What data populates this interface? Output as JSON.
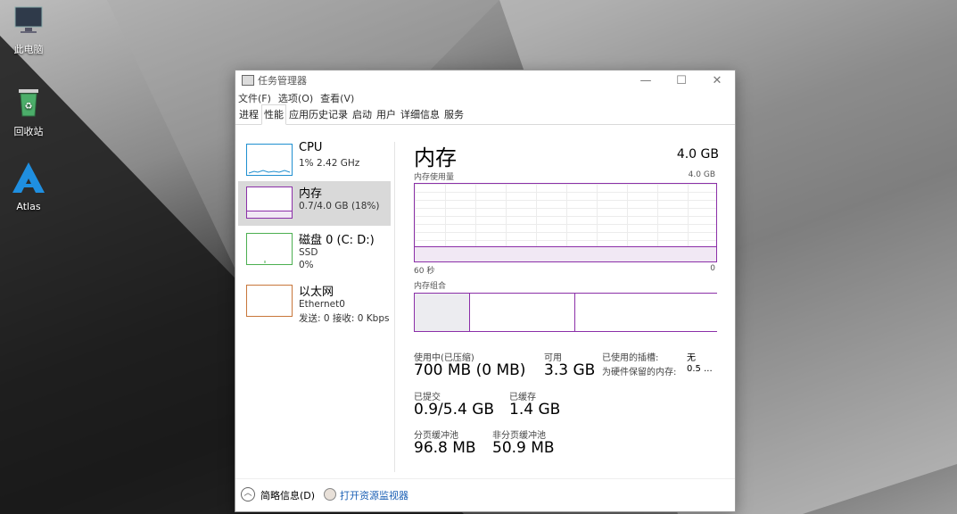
{
  "desktop": {
    "icons": [
      {
        "label": "此电脑",
        "icon": "computer-icon"
      },
      {
        "label": "回收站",
        "icon": "recycle-bin-icon"
      },
      {
        "label": "Atlas",
        "icon": "atlas-logo-icon"
      }
    ]
  },
  "window": {
    "title": "任务管理器",
    "menu": [
      "文件(F)",
      "选项(O)",
      "查看(V)"
    ],
    "tabs": [
      "进程",
      "性能",
      "应用历史记录",
      "启动",
      "用户",
      "详细信息",
      "服务"
    ],
    "active_tab": "性能"
  },
  "sidebar": {
    "items": [
      {
        "title": "CPU",
        "sub1": "1%  2.42 GHz",
        "sub2": "",
        "color": "#1f8fd0"
      },
      {
        "title": "内存",
        "sub1": "0.7/4.0 GB (18%)",
        "sub2": "",
        "color": "#8b2fa8"
      },
      {
        "title": "磁盘 0 (C: D:)",
        "sub1": "SSD",
        "sub2": "0%",
        "color": "#4caf50"
      },
      {
        "title": "以太网",
        "sub1": "Ethernet0",
        "sub2": "发送: 0  接收: 0 Kbps",
        "color": "#c8763a"
      }
    ]
  },
  "main": {
    "title": "内存",
    "total": "4.0 GB",
    "usage_label": "内存使用量",
    "usage_max": "4.0 GB",
    "x_left": "60 秒",
    "x_right": "0",
    "composition_label": "内存组合",
    "usage_fraction": 0.18,
    "composition_fractions": [
      0.18,
      0.35,
      0.47
    ]
  },
  "stats": {
    "in_use_label": "使用中(已压缩)",
    "in_use_value": "700 MB (0 MB)",
    "available_label": "可用",
    "available_value": "3.3 GB",
    "slots_used_label": "已使用的插槽:",
    "slots_used_value": "无",
    "hw_reserved_label": "为硬件保留的内存:",
    "hw_reserved_value": "0.5 ...",
    "committed_label": "已提交",
    "committed_value": "0.9/5.4 GB",
    "cached_label": "已缓存",
    "cached_value": "1.4 GB",
    "paged_pool_label": "分页缓冲池",
    "paged_pool_value": "96.8 MB",
    "nonpaged_pool_label": "非分页缓冲池",
    "nonpaged_pool_value": "50.9 MB"
  },
  "footer": {
    "fewer_details": "简略信息(D)",
    "open_resmon": "打开资源监视器"
  }
}
